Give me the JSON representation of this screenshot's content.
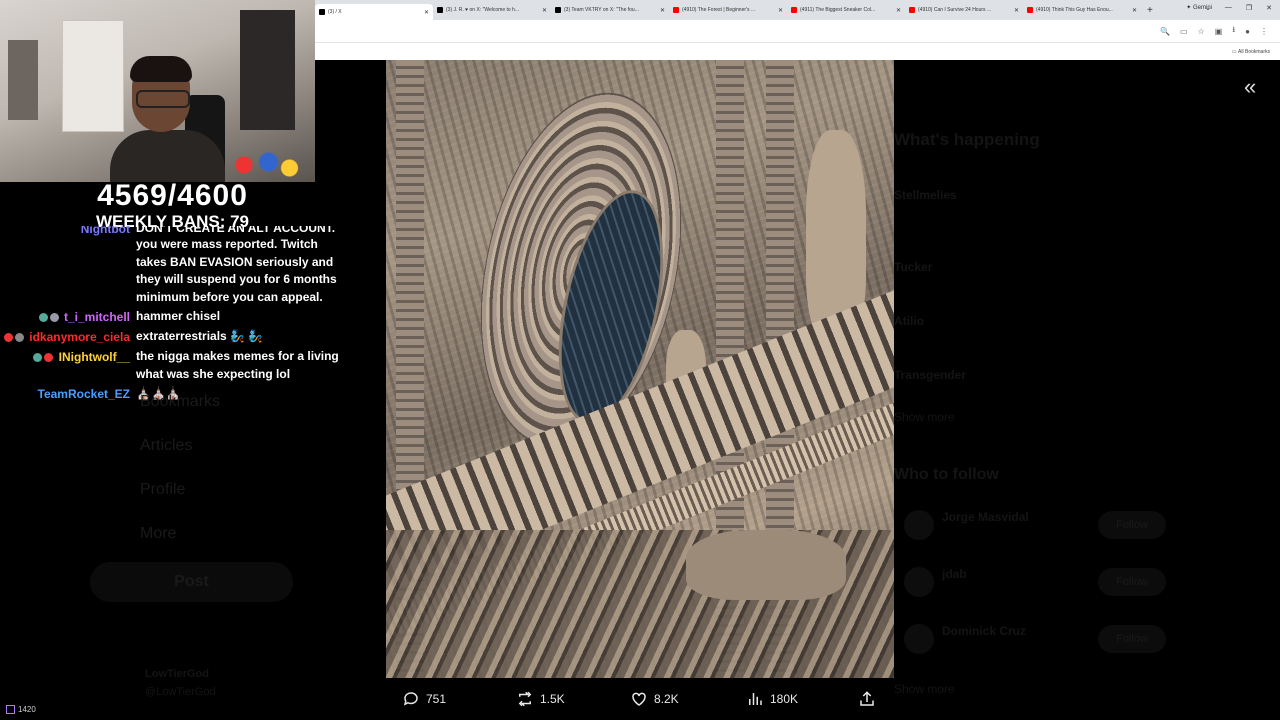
{
  "stream_overlay": {
    "ban_counter": "4569/4600",
    "weekly_bans": "WEEKLY BANS: 79",
    "viewer_count": "1420"
  },
  "chat": {
    "cutoff_line": "DON'T CREATE AN ALT ACCOUNT. If",
    "cutoff_user": "Nightbot",
    "messages": [
      {
        "user": "",
        "color": "#ffffff",
        "text": "you were mass reported. Twitch takes BAN EVASION seriously and they will suspend you for 6 months minimum before you can appeal."
      },
      {
        "user": "t_i_mitchell",
        "color": "#cf66ff",
        "text": "hammer chisel"
      },
      {
        "user": "idkanymore_ciela",
        "color": "#ff2a2a",
        "text": "extraterrestrials 🧞 🧞"
      },
      {
        "user": "INightwolf__",
        "color": "#ffd23a",
        "text": "the nigga makes memes for a living what was she expecting lol"
      },
      {
        "user": "TeamRocket_EZ",
        "color": "#4a9eff",
        "text": "⛪⛪⛪"
      }
    ]
  },
  "browser": {
    "tabs": [
      {
        "label": "(3) / X",
        "active": true,
        "color": "#000000"
      },
      {
        "label": "(3) J. R. ♥ on X: \"Welcome to h...",
        "active": false,
        "color": "#000000"
      },
      {
        "label": "(3) Team VKTRY on X: \"The fou...",
        "active": false,
        "color": "#000000"
      },
      {
        "label": "(4910) The Forest | Beginner's ...",
        "active": false,
        "color": "#ff0000"
      },
      {
        "label": "(4911) The Biggest Sneaker Col...",
        "active": false,
        "color": "#ff0000"
      },
      {
        "label": "(4910) Can I Survive 24 Hours ...",
        "active": false,
        "color": "#ff0000"
      },
      {
        "label": "(4910) Think This Guy Has Enou...",
        "active": false,
        "color": "#ff0000"
      }
    ],
    "new_tab": "+",
    "gemini": "Gemini",
    "all_bookmarks": "All Bookmarks"
  },
  "background_page": {
    "sidebar": [
      "Bookmarks",
      "Articles",
      "Profile",
      "More"
    ],
    "post_button": "Post",
    "account_name": "LowTierGod",
    "account_handle": "@LowTierGod",
    "right_column": {
      "whats_happening": "What's happening",
      "trends": [
        "Stellmelies",
        "Tucker",
        "Atilio",
        "Transgender"
      ],
      "show_more": "Show more",
      "who_to_follow": "Who to follow",
      "people": [
        {
          "name": "Jorge Masvidal",
          "follow": "Follow"
        },
        {
          "name": "jdab",
          "follow": "Follow"
        },
        {
          "name": "Dominick Cruz",
          "follow": "Follow"
        }
      ],
      "show_more_bottom": "Show more"
    }
  },
  "media_viewer": {
    "collapse_icon": "«",
    "actions": {
      "replies": "751",
      "reposts": "1.5K",
      "likes": "8.2K",
      "views": "180K"
    }
  }
}
